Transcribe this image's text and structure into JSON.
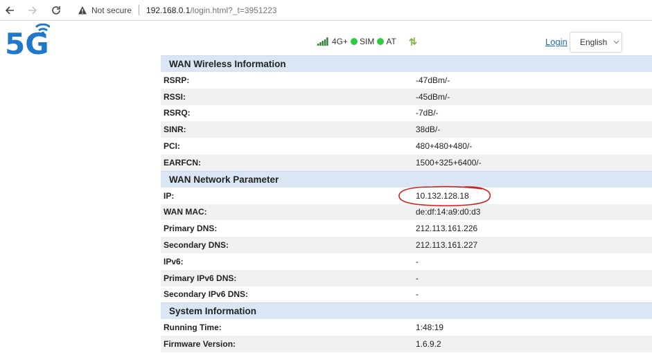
{
  "browser": {
    "security_label": "Not secure",
    "url_host": "192.168.0.1",
    "url_path": "/login.html?_t=3951223"
  },
  "header": {
    "logo_text": "5G",
    "network_type": "4G+",
    "sim_label": "SIM",
    "at_label": "AT",
    "login_label": "Login",
    "language": "English",
    "status_color": "#2ecc40",
    "accent_color": "#1f6fb7"
  },
  "sections": [
    {
      "title": "WAN Wireless Information",
      "rows": [
        {
          "label": "RSRP:",
          "value": "-47dBm/-"
        },
        {
          "label": "RSSI:",
          "value": "-45dBm/-"
        },
        {
          "label": "RSRQ:",
          "value": "-7dB/-"
        },
        {
          "label": "SINR:",
          "value": "38dB/-"
        },
        {
          "label": "PCI:",
          "value": "480+480+480/-"
        },
        {
          "label": "EARFCN:",
          "value": "1500+325+6400/-"
        }
      ]
    },
    {
      "title": "WAN Network Parameter",
      "rows": [
        {
          "label": "IP:",
          "value": "10.132.128.18"
        },
        {
          "label": "WAN MAC:",
          "value": "de:df:14:a9:d0:d3"
        },
        {
          "label": "Primary DNS:",
          "value": "212.113.161.226"
        },
        {
          "label": "Secondary DNS:",
          "value": "212.113.161.227"
        },
        {
          "label": "IPv6:",
          "value": "-"
        },
        {
          "label": "Primary IPv6 DNS:",
          "value": "-"
        },
        {
          "label": "Secondary IPv6 DNS:",
          "value": "-"
        }
      ]
    },
    {
      "title": "System Information",
      "rows": [
        {
          "label": "Running Time:",
          "value": "1:48:19"
        },
        {
          "label": "Firmware Version:",
          "value": "1.6.9.2"
        }
      ]
    }
  ]
}
